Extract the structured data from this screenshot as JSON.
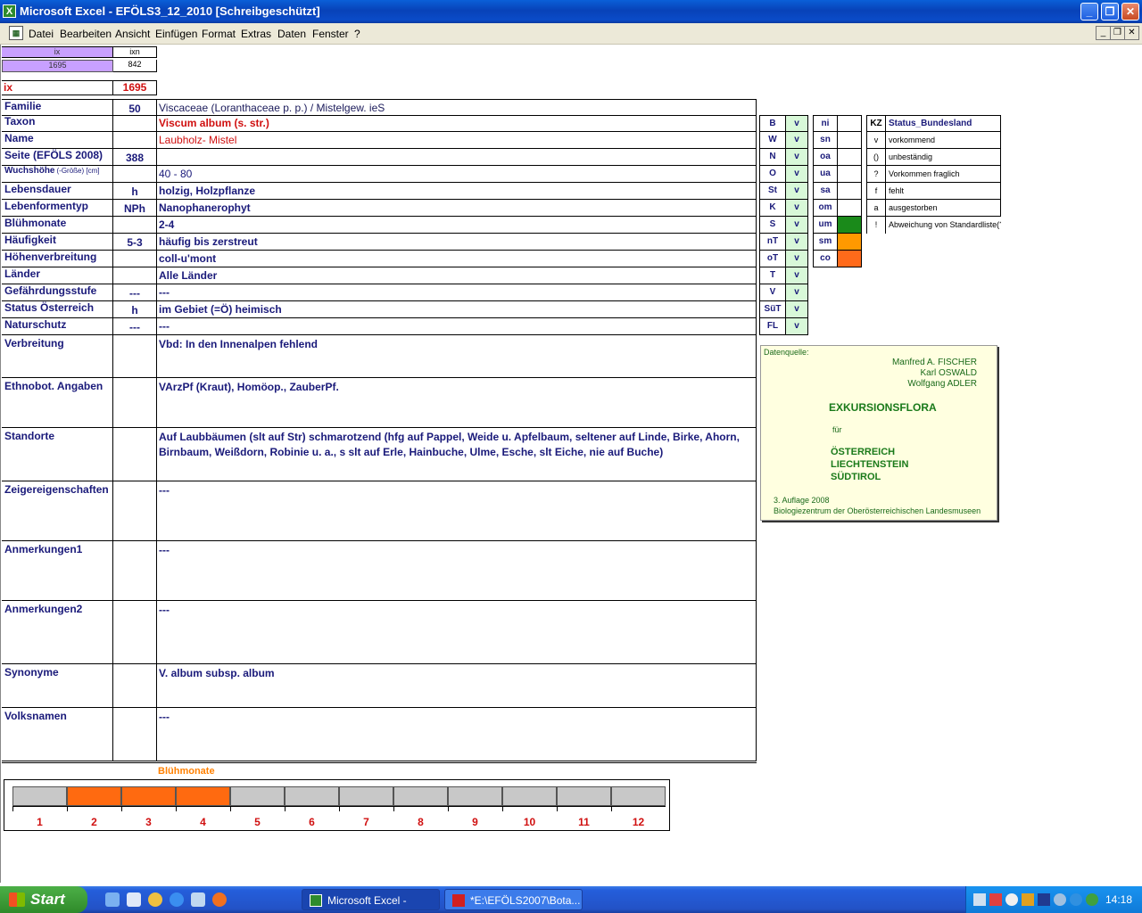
{
  "window": {
    "title": "Microsoft Excel - EFÖLS3_12_2010  [Schreibgeschützt]",
    "app_icon": "X",
    "min": "_",
    "max": "❐",
    "close": "✕"
  },
  "menu": {
    "items": [
      "Datei",
      "Bearbeiten",
      "Ansicht",
      "Einfügen",
      "Format",
      "Extras",
      "Daten",
      "Fenster",
      "?"
    ],
    "mdi_min": "_",
    "mdi_restore": "❐",
    "mdi_close": "✕"
  },
  "topcells": {
    "h1": "ix",
    "h2": "ixn",
    "v1": "1695",
    "v2": "842",
    "ix_label": "ix",
    "ix_value": "1695"
  },
  "rows": [
    {
      "label": "Familie",
      "code": "50",
      "value": "Viscaceae (Loranthaceae p. p.)  /  Mistelgew. ieS"
    },
    {
      "label": "Taxon",
      "code": "",
      "value": "Viscum album (s. str.)"
    },
    {
      "label": "Name",
      "code": "",
      "value": "Laubholz- Mistel"
    },
    {
      "label": "Seite (EFÖLS 2008)",
      "code": "388",
      "value": ""
    },
    {
      "label": "Wuchshöhe",
      "label_suffix": "(-Größe) [cm]",
      "code": "",
      "value": "40 - 80"
    },
    {
      "label": "Lebensdauer",
      "code": "h",
      "value": "holzig, Holzpflanze"
    },
    {
      "label": "Lebenformentyp",
      "code": "NPh",
      "value": "Nanophanerophyt"
    },
    {
      "label": "Blühmonate",
      "code": "",
      "value": "2-4"
    },
    {
      "label": "Häufigkeit",
      "code": "5-3",
      "value": "häufig bis zerstreut"
    },
    {
      "label": "Höhenverbreitung",
      "code": "",
      "value": "coll-u'mont"
    },
    {
      "label": "Länder",
      "code": "",
      "value": "Alle Länder"
    },
    {
      "label": "Gefährdungsstufe",
      "code": "---",
      "value": "---"
    },
    {
      "label": "Status Österreich",
      "code": "h",
      "value": "im Gebiet (=Ö) heimisch"
    },
    {
      "label": "Naturschutz",
      "code": "---",
      "value": "---"
    }
  ],
  "bigrows": [
    {
      "label": "Verbreitung",
      "value": "Vbd: In den Innenalpen fehlend",
      "value2": ""
    },
    {
      "label": "Ethnobot. Angaben",
      "value": "VArzPf (Kraut), Homöop., ZauberPf.",
      "value2": ""
    },
    {
      "label": "Standorte",
      "value": "Auf Laubbäumen (slt auf Str) schmarotzend (hfg auf Pappel, Weide u. Apfelbaum, seltener auf Linde, Birke, Ahorn,",
      "value2": "Birnbaum, Weißdorn, Robinie u. a., s slt auf Erle, Hainbuche, Ulme, Esche, slt Eiche, nie auf Buche)"
    },
    {
      "label": "Zeigereigenschaften",
      "value": "---",
      "value2": ""
    },
    {
      "label": "Anmerkungen1",
      "value": "---",
      "value2": ""
    },
    {
      "label": "Anmerkungen2",
      "value": "---",
      "value2": ""
    },
    {
      "label": "Synonyme",
      "value": "V. album subsp. album",
      "value2": ""
    },
    {
      "label": "Volksnamen",
      "value": "---",
      "value2": ""
    }
  ],
  "regions": [
    {
      "code": "B",
      "mark": "v"
    },
    {
      "code": "W",
      "mark": "v"
    },
    {
      "code": "N",
      "mark": "v"
    },
    {
      "code": "O",
      "mark": "v"
    },
    {
      "code": "St",
      "mark": "v"
    },
    {
      "code": "K",
      "mark": "v"
    },
    {
      "code": "S",
      "mark": "v"
    },
    {
      "code": "nT",
      "mark": "v"
    },
    {
      "code": "oT",
      "mark": "v"
    },
    {
      "code": "T",
      "mark": "v"
    },
    {
      "code": "V",
      "mark": "v"
    },
    {
      "code": "SüT",
      "mark": "v"
    },
    {
      "code": "FL",
      "mark": "v"
    }
  ],
  "zones": [
    {
      "code": "ni",
      "color": "#ffffff"
    },
    {
      "code": "sn",
      "color": "#ffffff"
    },
    {
      "code": "oa",
      "color": "#ffffff"
    },
    {
      "code": "ua",
      "color": "#ffffff"
    },
    {
      "code": "sa",
      "color": "#ffffff"
    },
    {
      "code": "om",
      "color": "#ffffff"
    },
    {
      "code": "um",
      "color": "#1a8a1a"
    },
    {
      "code": "sm",
      "color": "#ff9900"
    },
    {
      "code": "co",
      "color": "#ff6a1a"
    }
  ],
  "status_legend": {
    "kz": "KZ",
    "title": "Status_Bundesland",
    "items": [
      {
        "kz": "v",
        "text": "vorkommend"
      },
      {
        "kz": "()",
        "text": "unbeständig"
      },
      {
        "kz": "?",
        "text": "Vorkommen fraglich"
      },
      {
        "kz": "f",
        "text": "fehlt"
      },
      {
        "kz": "a",
        "text": "ausgestorben"
      },
      {
        "kz": "!",
        "text": "Abweichung von Standardliste(?)"
      }
    ]
  },
  "source": {
    "label": "Datenquelle:",
    "authors": [
      "Manfred A. FISCHER",
      "Karl OSWALD",
      "Wolfgang ADLER"
    ],
    "book": "EXKURSIONSFLORA",
    "fuer": "für",
    "countries": [
      "ÖSTERREICH",
      "LIECHTENSTEIN",
      "SÜDTIROL"
    ],
    "edition": "3. Auflage 2008",
    "publisher": "Biologiezentrum der Oberösterreichischen Landesmuseen"
  },
  "bloom": {
    "title": "Blühmonate",
    "months": [
      "1",
      "2",
      "3",
      "4",
      "5",
      "6",
      "7",
      "8",
      "9",
      "10",
      "11",
      "12"
    ],
    "active": [
      2,
      3,
      4
    ],
    "active_color": "#ff6a10",
    "inactive_color": "#c8c8c8"
  },
  "taskbar": {
    "start": "Start",
    "task1": "Microsoft Excel - EFÖ...",
    "task2": "*E:\\EFÖLS2007\\Bota...",
    "clock": "14:18"
  }
}
